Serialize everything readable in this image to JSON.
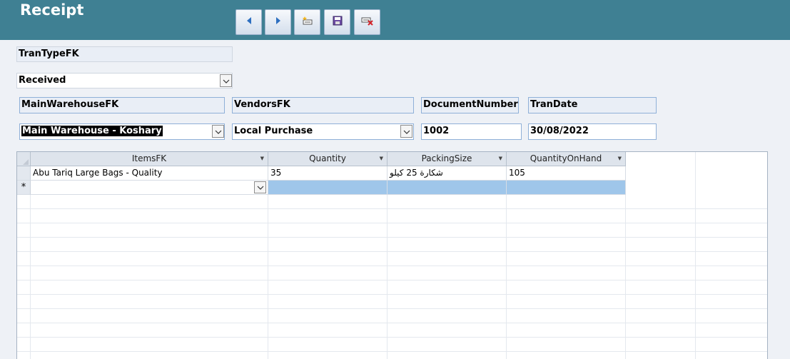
{
  "header": {
    "title": "Receipt"
  },
  "toolbar": {
    "buttons": [
      {
        "icon": "previous-record-icon"
      },
      {
        "icon": "next-record-icon"
      },
      {
        "icon": "new-record-icon"
      },
      {
        "icon": "save-record-icon"
      },
      {
        "icon": "delete-record-icon"
      }
    ]
  },
  "form": {
    "tran_type_label": "TranTypeFK",
    "tran_type_value": "Received",
    "main_warehouse_label": "MainWarehouseFK",
    "main_warehouse_value": "Main Warehouse - Koshary",
    "vendors_label": "VendorsFK",
    "vendors_value": "Local Purchase",
    "document_number_label": "DocumentNumber",
    "document_number_value": "1002",
    "tran_date_label": "TranDate",
    "tran_date_value": "30/08/2022"
  },
  "grid": {
    "columns": [
      "ItemsFK",
      "Quantity",
      "PackingSize",
      "QuantityOnHand"
    ],
    "rows": [
      {
        "items": "Abu Tariq Large Bags - Quality",
        "quantity": "35",
        "packing_size": "شكارة 25 كيلو",
        "quantity_on_hand": "105"
      }
    ],
    "new_row_marker": "*"
  },
  "colors": {
    "header_bg": "#3f8093",
    "new_row_bg": "#9fc6ea",
    "page_bg": "#eef1f6"
  }
}
